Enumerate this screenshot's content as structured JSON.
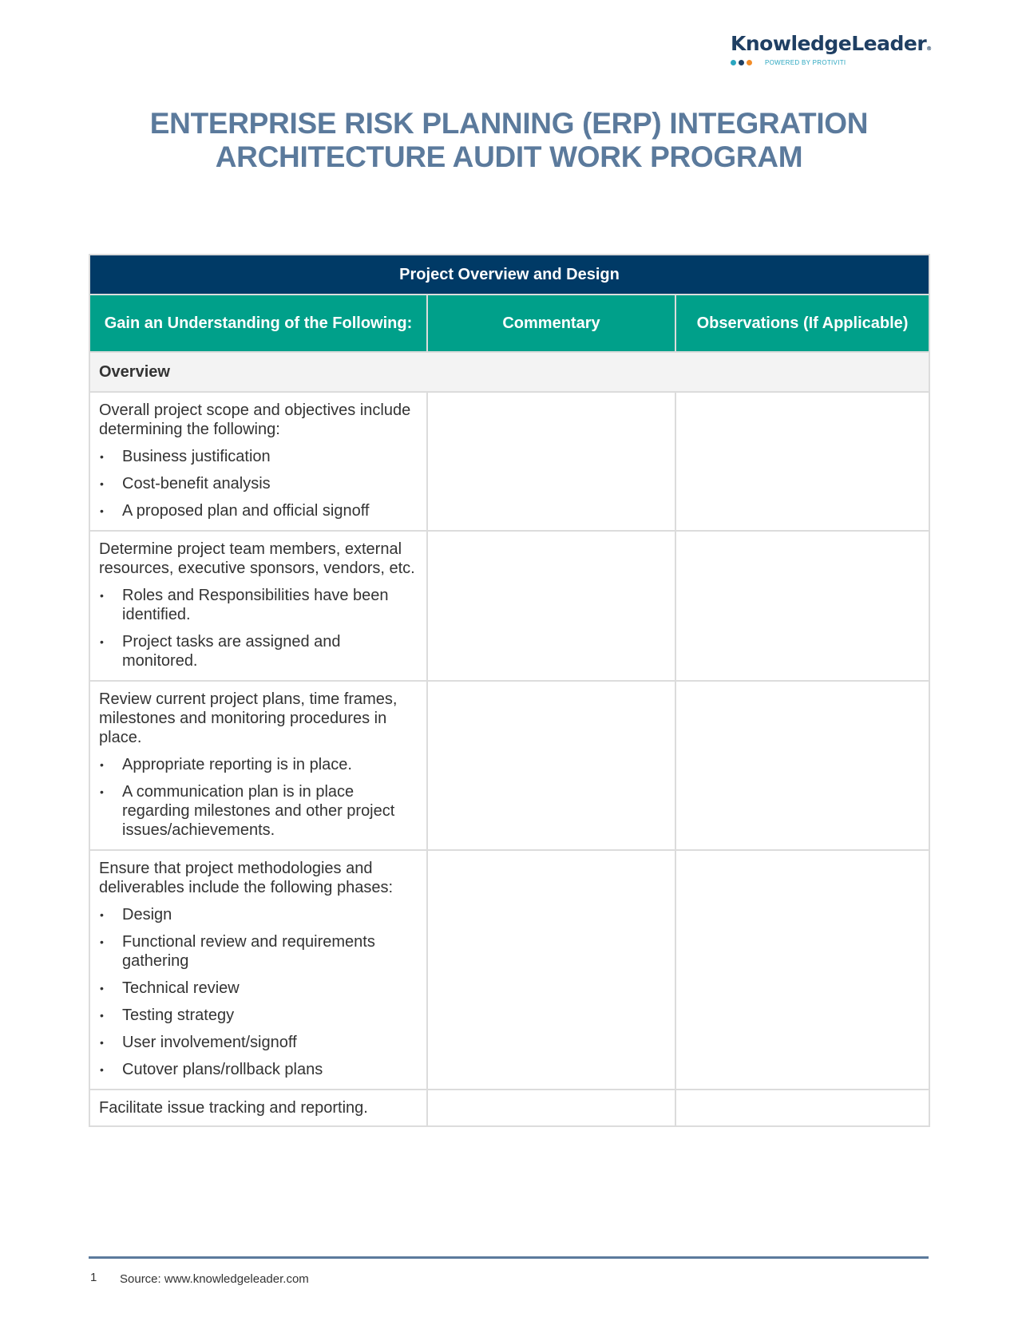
{
  "logo": {
    "name": "KnowledgeLeader",
    "mark": "®",
    "powered_by": "POWERED BY PROTIVITI",
    "dot_colors": [
      "#2aa6c0",
      "#1f3f63",
      "#f28c28"
    ]
  },
  "title": {
    "line1": "ENTERPRISE RISK PLANNING (ERP) INTEGRATION",
    "line2": "ARCHITECTURE AUDIT WORK PROGRAM"
  },
  "table": {
    "band_title": "Project Overview and Design",
    "columns": [
      "Gain an Understanding of the Following:",
      "Commentary",
      "Observations (If Applicable)"
    ],
    "section": "Overview",
    "rows": [
      {
        "text": "Overall project scope and objectives include determining the following:",
        "bullets": [
          "Business justification",
          "Cost-benefit analysis",
          "A proposed plan and official signoff"
        ]
      },
      {
        "text": "Determine project team members, external resources, executive sponsors, vendors, etc.",
        "bullets": [
          "Roles and Responsibilities have been identified.",
          "Project tasks are assigned and monitored."
        ]
      },
      {
        "text": "Review current project plans, time frames, milestones and monitoring procedures in place.",
        "bullets": [
          "Appropriate reporting is in place.",
          "A communication plan is in place regarding milestones and other project issues/achievements."
        ]
      },
      {
        "text": "Ensure that project methodologies and deliverables include the following phases:",
        "bullets": [
          "Design",
          "Functional review and requirements gathering",
          "Technical review",
          "Testing strategy",
          "User involvement/signoff",
          "Cutover plans/rollback plans"
        ]
      },
      {
        "text": "Facilitate issue tracking and reporting.",
        "bullets": []
      }
    ],
    "bullet_glyph": "•"
  },
  "footer": {
    "page_number": "1",
    "source": "Source: www.knowledgeleader.com"
  }
}
